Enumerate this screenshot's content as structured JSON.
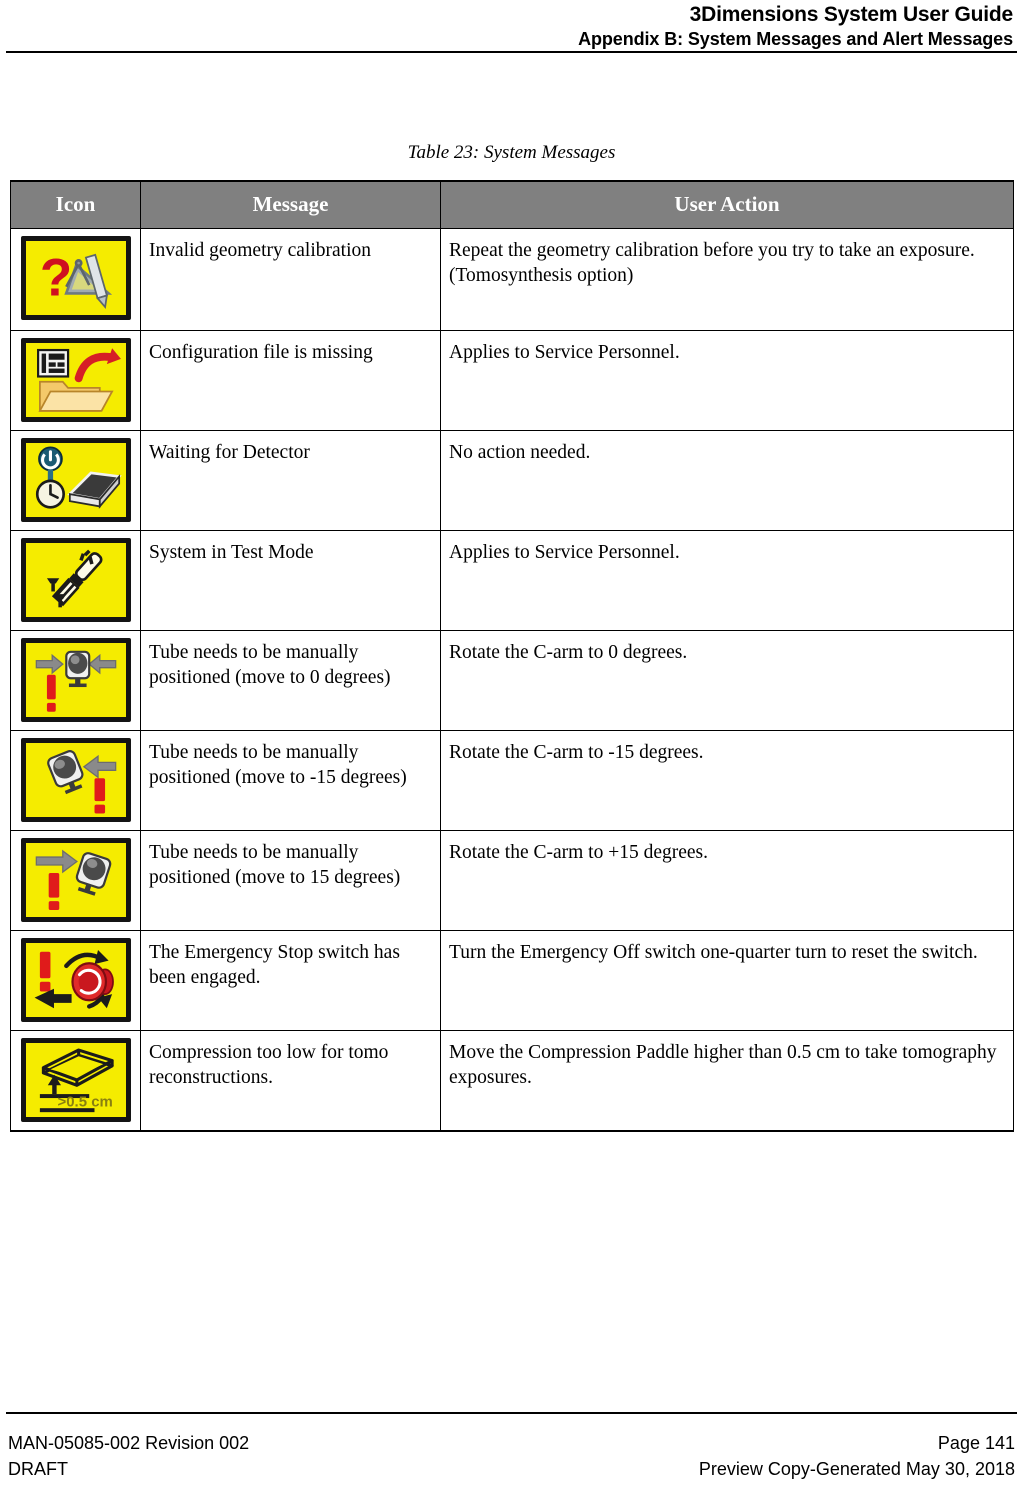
{
  "header": {
    "title": "3Dimensions System User Guide",
    "subtitle": "Appendix B: System Messages and Alert Messages"
  },
  "table": {
    "caption": "Table 23: System Messages",
    "columns": [
      "Icon",
      "Message",
      "User Action"
    ],
    "rows": [
      {
        "icon": "invalid-geometry-calibration-icon",
        "message": "Invalid geometry calibration",
        "user_action": "Repeat the geometry calibration before you try to take an exposure. (Tomosynthesis option)"
      },
      {
        "icon": "configuration-file-missing-icon",
        "message": "Configuration file is missing",
        "user_action": "Applies to Service Personnel."
      },
      {
        "icon": "waiting-for-detector-icon",
        "message": "Waiting for Detector",
        "user_action": "No action needed."
      },
      {
        "icon": "test-mode-screwdriver-icon",
        "message": "System in Test Mode",
        "user_action": "Applies to Service Personnel."
      },
      {
        "icon": "tube-position-0-degrees-icon",
        "message": "Tube needs to be manually positioned (move to 0 degrees)",
        "user_action": "Rotate the C-arm to 0 degrees."
      },
      {
        "icon": "tube-position-minus-15-degrees-icon",
        "message": "Tube needs to be manually positioned (move to -15 degrees)",
        "user_action": "Rotate the C-arm to -15 degrees."
      },
      {
        "icon": "tube-position-plus-15-degrees-icon",
        "message": "Tube needs to be manually positioned (move to 15 degrees)",
        "user_action": "Rotate the C-arm to +15 degrees."
      },
      {
        "icon": "emergency-stop-switch-icon",
        "message": "The Emergency Stop switch has been engaged.",
        "user_action": "Turn the Emergency Off switch one-quarter turn to reset the switch."
      },
      {
        "icon": "compression-too-low-icon",
        "message": "Compression too low for tomo reconstructions.",
        "user_action": "Move the Compression Paddle higher than 0.5 cm to take tomography exposures."
      }
    ],
    "icon_labels": {
      "compression_threshold": ">0.5 cm"
    }
  },
  "footer": {
    "doc_number": "MAN-05085-002 Revision 002",
    "status": "DRAFT",
    "page": "Page 141",
    "notice": "Preview Copy-Generated May 30, 2018"
  },
  "colors": {
    "icon_background": "#f5ec00",
    "icon_border": "#141414",
    "header_row_background": "#808080",
    "alert_red": "#e01b1b",
    "arrow_gray": "#8a8a8a"
  }
}
